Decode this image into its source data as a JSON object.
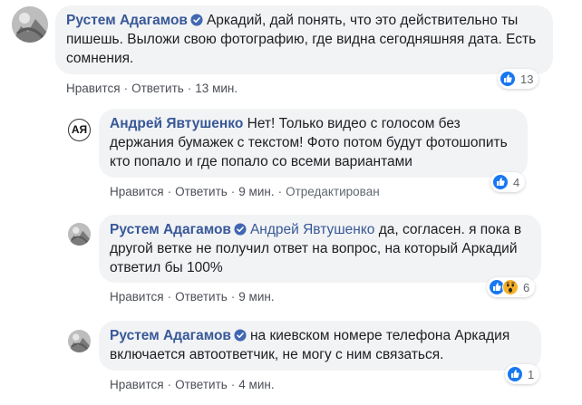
{
  "comments": [
    {
      "author": "Рустем Адагамов",
      "text": "Аркадий, дай понять, что это действительно ты пишешь. Выложи свою фотографию, где видна сегодняшняя дата. Есть сомнения.",
      "like_label": "Нравится",
      "reply_label": "Ответить",
      "time": "13 мин.",
      "reactions": [
        "like"
      ],
      "reaction_count": "13"
    },
    {
      "author": "Андрей Явтушенко",
      "avatar_initials": "АЯ",
      "text": "Нет! Только видео с голосом без держания бумажек с текстом! Фото потом будут фотошопить кто попало и где попало со всеми вариантами",
      "like_label": "Нравится",
      "reply_label": "Ответить",
      "time": "9 мин.",
      "edited_label": "Отредактирован",
      "reactions": [
        "like"
      ],
      "reaction_count": "4"
    },
    {
      "author": "Рустем Адагамов",
      "mention": "Андрей Явтушенко",
      "text": "да, согласен. я пока в другой ветке не получил ответ на вопрос, на который Аркадий ответил бы 100%",
      "like_label": "Нравится",
      "reply_label": "Ответить",
      "time": "9 мин.",
      "reactions": [
        "like",
        "wow"
      ],
      "reaction_count": "6"
    },
    {
      "author": "Рустем Адагамов",
      "text": "на киевском номере телефона Аркадия включается автоответчик, не могу с ним связаться.",
      "like_label": "Нравится",
      "reply_label": "Ответить",
      "time": "4 мин.",
      "reactions": [
        "like"
      ],
      "reaction_count": "1"
    }
  ],
  "colors": {
    "bubble_bg": "#f2f3f5",
    "author": "#385898",
    "meta": "#606770",
    "like_blue": "#1877f2",
    "wow_yellow": "#f7b125"
  }
}
